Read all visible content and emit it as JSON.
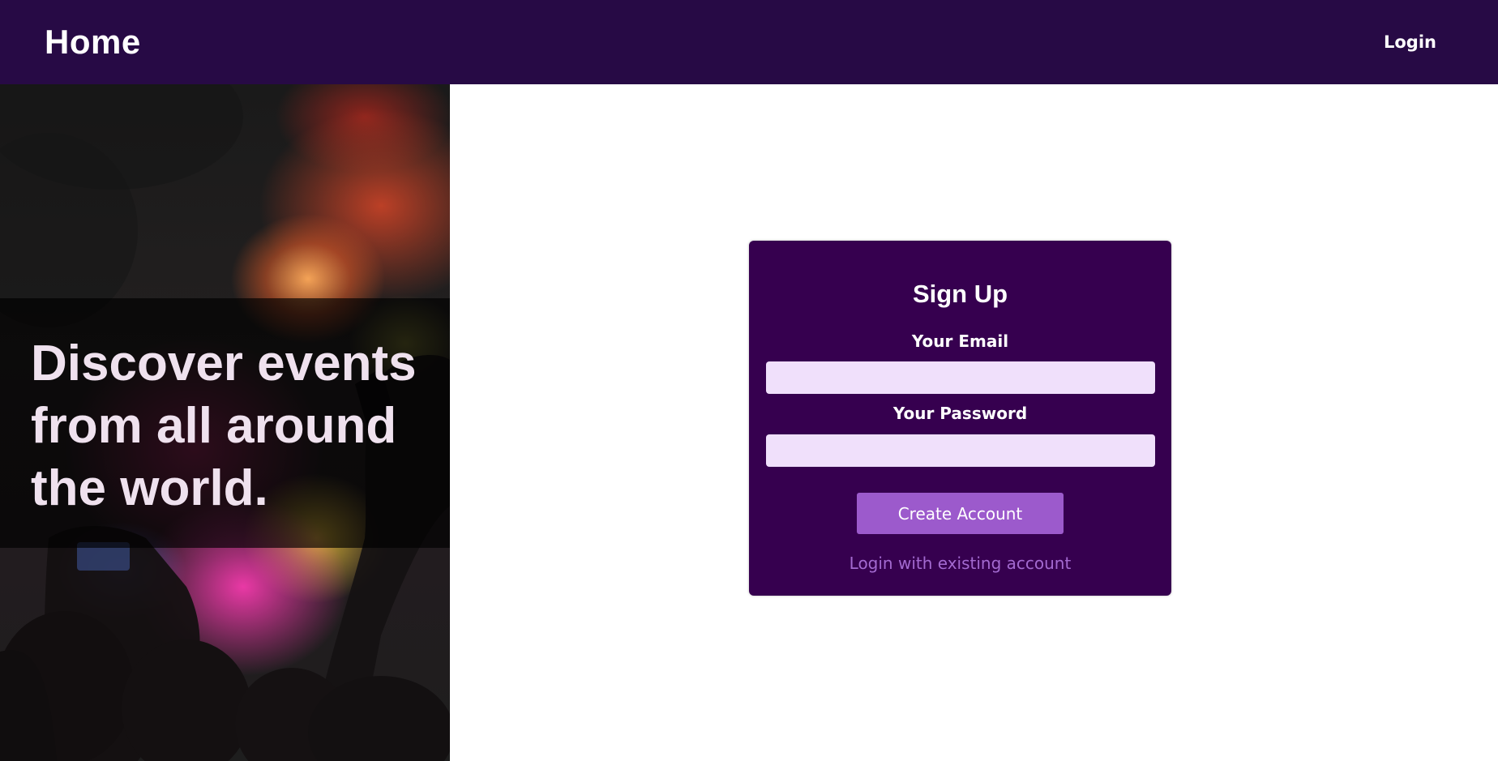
{
  "navbar": {
    "brand": "Home",
    "login_link": "Login",
    "background_color": "#270a45"
  },
  "hero": {
    "tagline": "Discover events from all around the world.",
    "image": "concert-crowd-photo"
  },
  "signup_form": {
    "title": "Sign Up",
    "email_label": "Your Email",
    "email_value": "",
    "password_label": "Your Password",
    "password_value": "",
    "submit_label": "Create Account",
    "alt_link": "Login with existing account",
    "card_color": "#36004f",
    "button_color": "#9c5acc",
    "input_color": "#f0e0fb"
  }
}
